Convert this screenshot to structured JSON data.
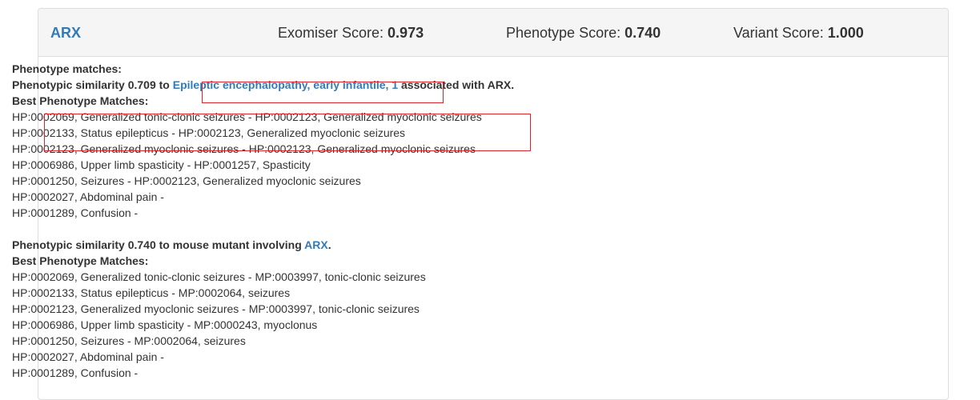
{
  "header": {
    "gene": "ARX",
    "exomiser_label": "Exomiser Score: ",
    "exomiser_value": "0.973",
    "phenotype_label": "Phenotype Score: ",
    "phenotype_value": "0.740",
    "variant_label": "Variant Score: ",
    "variant_value": "1.000"
  },
  "human": {
    "heading": "Phenotype matches:",
    "sim_prefix": "Phenotypic similarity 0.709 to ",
    "disease_link": "Epileptic encephalopathy, early infantile, 1",
    "sim_suffix": " associated with ARX.",
    "best_heading": "Best Phenotype Matches:",
    "matches": [
      "HP:0002069, Generalized tonic-clonic seizures - HP:0002123, Generalized myoclonic seizures",
      "HP:0002133, Status epilepticus - HP:0002123, Generalized myoclonic seizures",
      "HP:0002123, Generalized myoclonic seizures - HP:0002123, Generalized myoclonic seizures",
      "HP:0006986, Upper limb spasticity - HP:0001257, Spasticity",
      "HP:0001250, Seizures - HP:0002123, Generalized myoclonic seizures",
      "HP:0002027, Abdominal pain -",
      "HP:0001289, Confusion -"
    ]
  },
  "mouse": {
    "sim_prefix": "Phenotypic similarity 0.740 to mouse mutant involving ",
    "gene_link": "ARX",
    "sim_suffix": ".",
    "best_heading": "Best Phenotype Matches:",
    "matches": [
      "HP:0002069, Generalized tonic-clonic seizures - MP:0003997, tonic-clonic seizures",
      "HP:0002133, Status epilepticus - MP:0002064, seizures",
      "HP:0002123, Generalized myoclonic seizures - MP:0003997, tonic-clonic seizures",
      "HP:0006986, Upper limb spasticity - MP:0000243, myoclonus",
      "HP:0001250, Seizures - MP:0002064, seizures",
      "HP:0002027, Abdominal pain -",
      "HP:0001289, Confusion -"
    ]
  },
  "colors": {
    "link": "#337ab7",
    "highlight_box": "#d9252b",
    "heading_bg": "#f5f5f5"
  }
}
